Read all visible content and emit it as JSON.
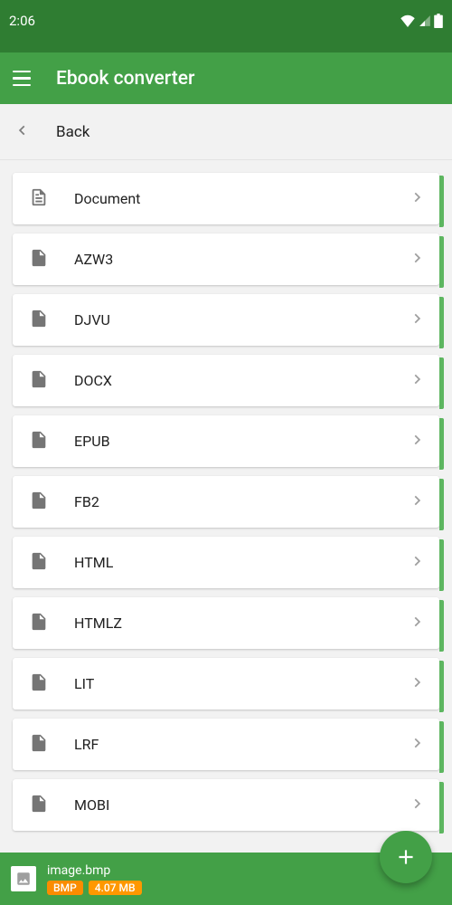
{
  "status": {
    "time": "2:06"
  },
  "appbar": {
    "title": "Ebook converter"
  },
  "backrow": {
    "label": "Back"
  },
  "formats": [
    {
      "label": "Document",
      "icon": "document"
    },
    {
      "label": "AZW3",
      "icon": "file"
    },
    {
      "label": "DJVU",
      "icon": "file"
    },
    {
      "label": "DOCX",
      "icon": "file"
    },
    {
      "label": "EPUB",
      "icon": "file"
    },
    {
      "label": "FB2",
      "icon": "file"
    },
    {
      "label": "HTML",
      "icon": "file"
    },
    {
      "label": "HTMLZ",
      "icon": "file"
    },
    {
      "label": "LIT",
      "icon": "file"
    },
    {
      "label": "LRF",
      "icon": "file"
    },
    {
      "label": "MOBI",
      "icon": "file"
    }
  ],
  "bottom": {
    "filename": "image.bmp",
    "ext_badge": "BMP",
    "size_badge": "4.07 MB"
  }
}
